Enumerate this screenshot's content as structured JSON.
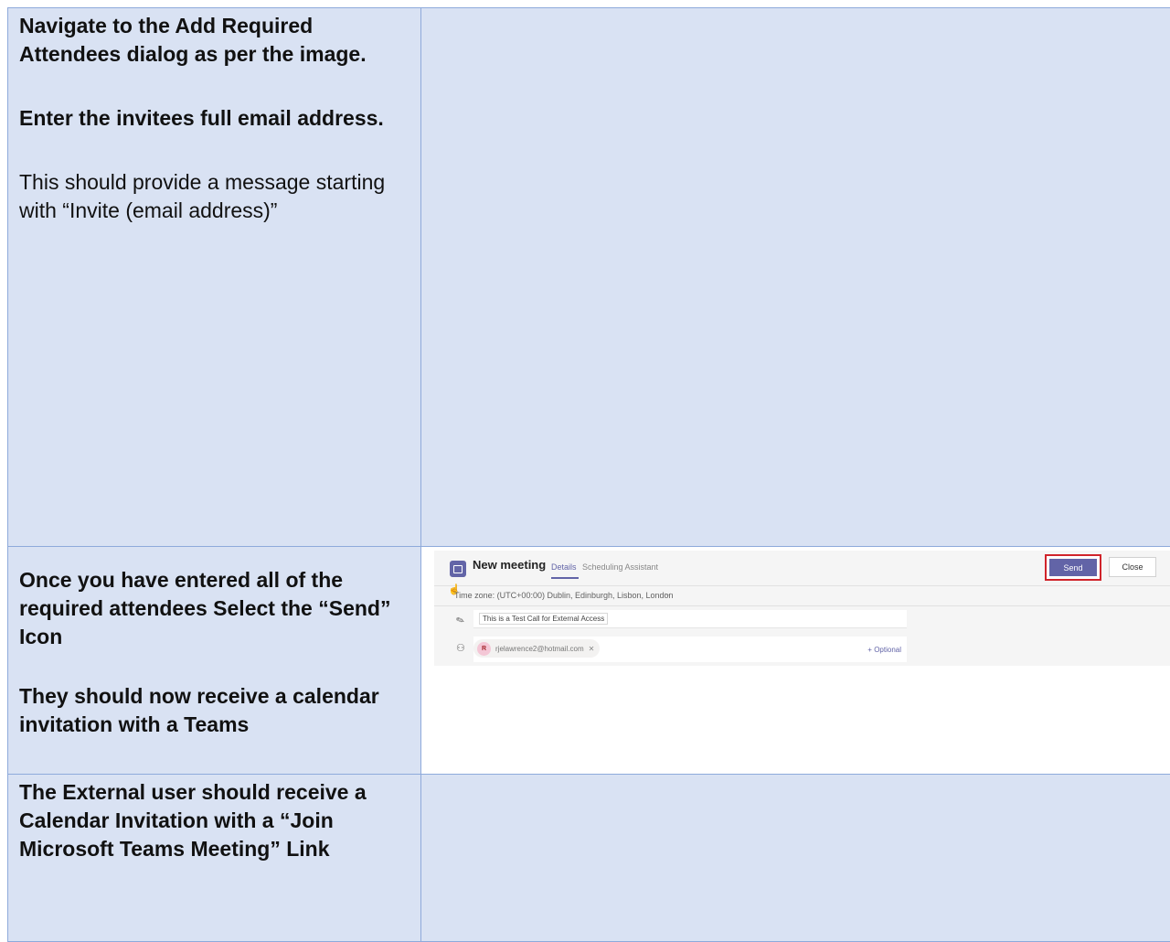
{
  "rows": [
    {
      "paragraphs": [
        {
          "text": "Navigate to the Add Required Attendees dialog as per the image.",
          "bold": true
        },
        {
          "text": "Enter the invitees full email address.",
          "bold": true
        },
        {
          "text": "This should provide a message starting with “Invite (email address)”",
          "bold": false
        }
      ]
    },
    {
      "paragraphs": [
        {
          "text": "Once you have entered all of the required attendees Select the “Send” Icon",
          "bold": true
        },
        {
          "text": "They should now receive a calendar invitation with a Teams",
          "bold": true
        }
      ]
    },
    {
      "paragraphs": [
        {
          "text": "The External user should receive a Calendar Invitation with a “Join Microsoft Teams Meeting” Link",
          "bold": true
        }
      ]
    }
  ],
  "screenshot": {
    "title": "New meeting",
    "tabs": [
      "Details",
      "Scheduling Assistant"
    ],
    "send_label": "Send",
    "close_label": "Close",
    "timezone": "Time zone: (UTC+00:00) Dublin, Edinburgh, Lisbon, London",
    "meeting_title": "This is a Test Call for External Access",
    "attendee_initial": "R",
    "attendee_email": "rjelawrence2@hotmail.com",
    "optional_label": "+ Optional",
    "accent_color": "#6264a7",
    "highlight_color": "#d0242b"
  }
}
